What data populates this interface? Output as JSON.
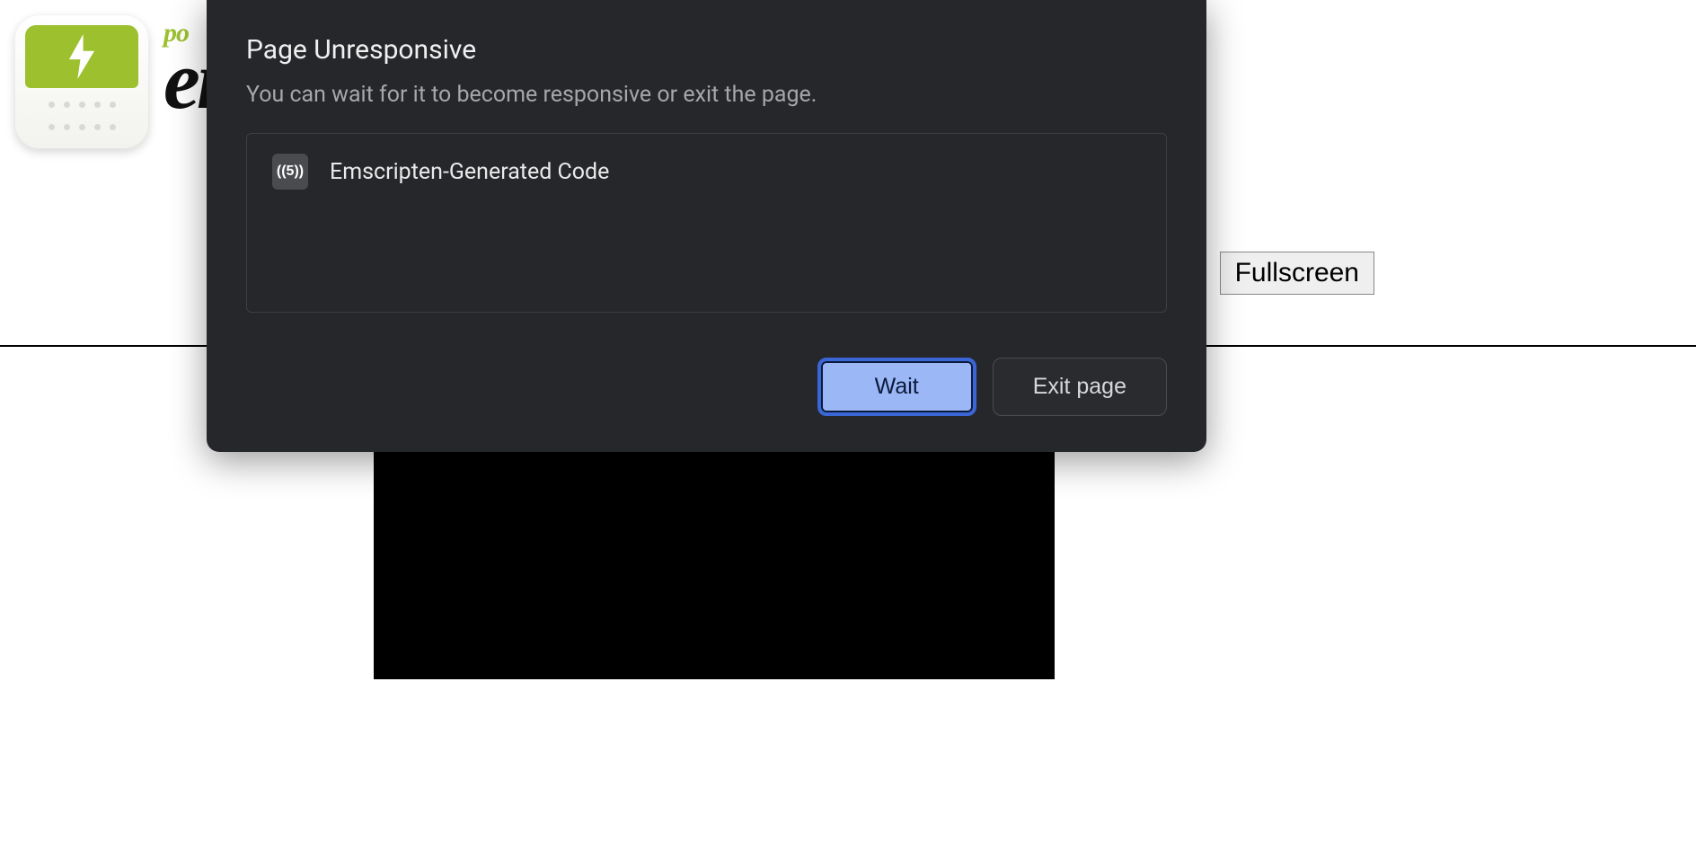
{
  "page": {
    "wordmark_small": "po",
    "wordmark_large": "en",
    "fullscreen_label": "Fullscreen"
  },
  "dialog": {
    "title": "Page Unresponsive",
    "subtitle": "You can wait for it to become responsive or exit the page.",
    "items": [
      {
        "favicon_text": "((5))",
        "label": "Emscripten-Generated Code"
      }
    ],
    "wait_label": "Wait",
    "exit_label": "Exit page"
  }
}
